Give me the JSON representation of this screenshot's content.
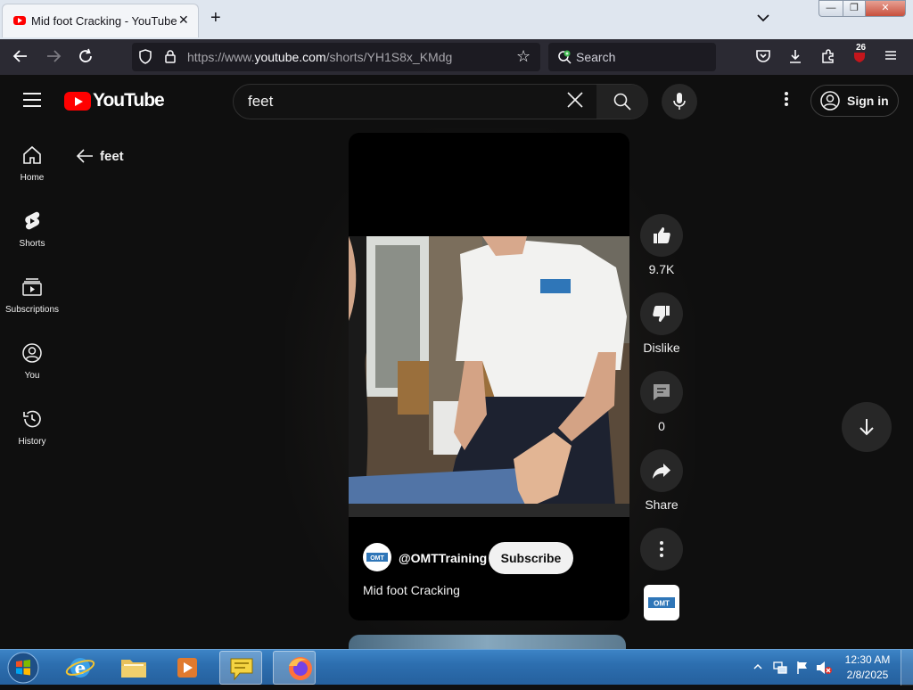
{
  "browser": {
    "tab_title": "Mid foot Cracking - YouTube",
    "url_prefix": "https://www.",
    "url_domain": "youtube.com",
    "url_path": "/shorts/YH1S8x_KMdg",
    "search_placeholder": "Search",
    "notification_badge": "26"
  },
  "youtube": {
    "logo_text": "YouTube",
    "search_value": "feet",
    "sign_in_label": "Sign in",
    "back_label": "feet",
    "sidebar": [
      {
        "label": "Home",
        "icon": "home-icon"
      },
      {
        "label": "Shorts",
        "icon": "shorts-icon"
      },
      {
        "label": "Subscriptions",
        "icon": "subscriptions-icon"
      },
      {
        "label": "You",
        "icon": "you-icon"
      },
      {
        "label": "History",
        "icon": "history-icon"
      }
    ],
    "short": {
      "channel": "@OMTTraining",
      "subscribe_label": "Subscribe",
      "title": "Mid foot Cracking",
      "logo_text": "OMT"
    },
    "actions": {
      "likes": "9.7K",
      "dislike_label": "Dislike",
      "comments": "0",
      "share_label": "Share"
    }
  },
  "taskbar": {
    "time": "12:30 AM",
    "date": "2/8/2025"
  },
  "colors": {
    "youtube_bg": "#0f0f0f",
    "youtube_red": "#ff0000",
    "browser_toolbar": "#2b2a33",
    "taskbar_blue": "#2d6fb0"
  }
}
